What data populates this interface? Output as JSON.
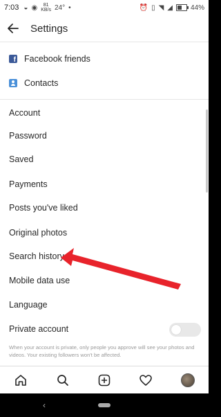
{
  "status_bar": {
    "time": "7:03",
    "speed_value": "81",
    "speed_unit": "KB/s",
    "temperature": "24°",
    "battery": "44%",
    "battery_level": 0.44
  },
  "app_bar": {
    "title": "Settings"
  },
  "list": {
    "facebook_friends": "Facebook friends",
    "contacts": "Contacts",
    "section_account": "Account",
    "items": [
      "Password",
      "Saved",
      "Payments",
      "Posts you've liked",
      "Original photos",
      "Search history",
      "Mobile data use",
      "Language",
      "Private account"
    ],
    "private_account_on": false,
    "private_note": "When your account is private, only people you approve will see your photos and videos. Your existing followers won't be affected."
  },
  "colors": {
    "accent_arrow": "#e8232b",
    "facebook": "#3b5998",
    "contacts": "#4a90d9"
  },
  "icons": {
    "home": "home-icon",
    "search": "search-icon",
    "add": "add-post-icon",
    "activity": "heart-icon",
    "profile": "profile-avatar"
  }
}
